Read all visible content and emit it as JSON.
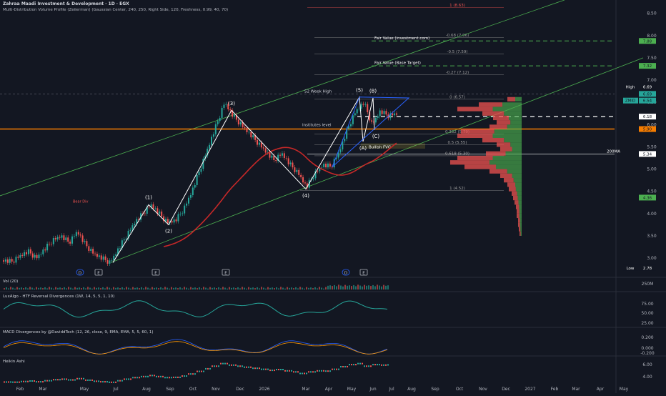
{
  "header": {
    "title": "Zahraa Maadi Investment & Development · 1D · EGX",
    "indicator": "Multi-Distribution Volume Profile (Zeiierman) (Gaussian Center, 240, 250, Right Side, 120, Freshness, 0.99, 40, 70)"
  },
  "colors": {
    "background": "#131722",
    "up": "#26a69a",
    "down": "#ef5350",
    "ma200": "#c62828",
    "channel": "#4caf50",
    "institutes": "#f57c00",
    "fib": "#9e9e9e"
  },
  "chart_data": {
    "type": "candlestick",
    "price_axis": {
      "ticks": [
        3.0,
        3.5,
        4.0,
        4.5,
        5.0,
        5.5,
        6.0,
        6.5,
        7.0,
        7.5,
        8.0,
        8.5
      ],
      "range": [
        2.6,
        8.8
      ]
    },
    "time_axis": {
      "ticks": [
        "Feb",
        "Mar",
        "May",
        "Jul",
        "Aug",
        "Sep",
        "Oct",
        "Nov",
        "Dec",
        "2026",
        "Mar",
        "Apr",
        "May",
        "Jun",
        "Jul",
        "Aug",
        "Sep",
        "Oct",
        "Nov",
        "Dec",
        "2027",
        "Feb",
        "Mar",
        "Apr",
        "May"
      ]
    },
    "price_path": [
      2.95,
      2.92,
      3.05,
      3.15,
      3.0,
      3.2,
      3.4,
      3.5,
      3.35,
      3.6,
      3.3,
      3.1,
      3.0,
      2.9,
      3.2,
      3.5,
      3.8,
      4.0,
      4.2,
      4.0,
      3.8,
      3.85,
      4.1,
      4.5,
      5.0,
      5.5,
      6.0,
      6.5,
      6.2,
      6.0,
      5.8,
      5.6,
      5.4,
      5.2,
      5.35,
      5.1,
      4.9,
      4.6,
      4.9,
      5.1,
      5.05,
      5.4,
      5.9,
      6.3,
      6.5,
      6.0,
      6.3,
      6.2,
      6.25
    ],
    "elliott_waves": [
      "(1)",
      "(2)",
      "(3)",
      "(4)",
      "(5)",
      "(A)",
      "(B)",
      "(C)"
    ],
    "price_labels": [
      {
        "label": "High",
        "value": "6.69"
      },
      {
        "label": "",
        "value": "6.69"
      },
      {
        "label": "ZMID",
        "value": "6.54"
      },
      {
        "label": "",
        "value": "6.18"
      },
      {
        "label": "",
        "value": "5.90"
      },
      {
        "label": "",
        "value": "5.34"
      },
      {
        "label": "",
        "value": "4.36"
      },
      {
        "label": "Low",
        "value": "2.78"
      },
      {
        "label": "",
        "value": "7.88"
      },
      {
        "label": "",
        "value": "7.32"
      }
    ],
    "fib_levels": [
      {
        "text": "1 (8.63)",
        "value": 8.63
      },
      {
        "text": "-0.68 (7.96)",
        "value": 7.96
      },
      {
        "text": "-0.5 (7.59)",
        "value": 7.59
      },
      {
        "text": "-0.27 (7.12)",
        "value": 7.12
      },
      {
        "text": "0 (6.57)",
        "value": 6.57
      },
      {
        "text": "0.382 (5.79)",
        "value": 5.79
      },
      {
        "text": "0.5 (5.55)",
        "value": 5.55
      },
      {
        "text": "0.618 (5.30)",
        "value": 5.3
      },
      {
        "text": "1 (4.52)",
        "value": 4.52
      }
    ],
    "annotations": {
      "fair_value_investment": "Fair Value (investment.com)",
      "fair_value_base": "Fair Value (Base Target)",
      "week52": "52 Week High",
      "institutes": "Institutes level",
      "bullish_fvg": "Bullish FVG",
      "ma200": "200MA",
      "bear_div": "Bear Div"
    },
    "panes": [
      {
        "name": "Vol (20)",
        "ticks": [
          "250M"
        ]
      },
      {
        "name": "LuxAlgo - HTF Reversal Divergences (1W, 14, 5, 5, 1, 10)",
        "ticks": [
          "75.00",
          "50.00",
          "25.00"
        ]
      },
      {
        "name": "MACD Divergences by @DaviddTech (12, 26, close, 9, EMA, EMA, 5, 5, 60, 1)",
        "ticks": [
          "0.200",
          "0.000",
          "-0.200"
        ]
      },
      {
        "name": "Heikin Ashi",
        "ticks": [
          "6.00",
          "4.00"
        ]
      }
    ]
  }
}
